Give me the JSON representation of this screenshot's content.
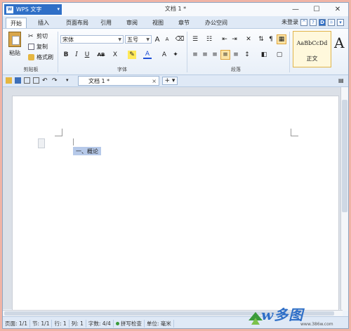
{
  "app": {
    "name": "WPS 文字",
    "logo": "W",
    "doc_title": "文档 1 *"
  },
  "window_controls": [
    "—",
    "☐",
    "✕"
  ],
  "tabs": [
    {
      "label": "开始",
      "active": true
    },
    {
      "label": "插入"
    },
    {
      "label": "页面布局"
    },
    {
      "label": "引用"
    },
    {
      "label": "审阅"
    },
    {
      "label": "视图"
    },
    {
      "label": "章节"
    },
    {
      "label": "办公空间"
    }
  ],
  "right_controls": {
    "login": "未登录",
    "icons": [
      "^",
      "?",
      "D"
    ]
  },
  "ribbon": {
    "clipboard": {
      "paste": "粘贴",
      "cut": "剪切",
      "copy": "复制",
      "format_painter": "格式刷",
      "group": "剪贴板"
    },
    "font": {
      "name": "宋体",
      "size": "五号",
      "group": "字体",
      "grow": "A",
      "shrink": "A",
      "bold": "B",
      "italic": "I",
      "underline": "U",
      "strike": "AB",
      "superscript": "X",
      "font_color": "A"
    },
    "paragraph": {
      "group": "段落"
    },
    "styles": {
      "preview": "AaBbCcDd",
      "name": "正文",
      "big": "A"
    }
  },
  "doc_tab": {
    "label": "文档 1 *",
    "close": "×",
    "add": "+ ▾"
  },
  "document": {
    "selected_text": "一、概论"
  },
  "status": {
    "page": "页面: 1/1",
    "section": "节: 1/1",
    "line": "行: 1",
    "col": "列: 1",
    "words": "字数: 4/4",
    "spell": "拼写检查",
    "unit": "单位: 毫米"
  },
  "watermark": {
    "text": "w多图",
    "url": "www.386w.com"
  }
}
